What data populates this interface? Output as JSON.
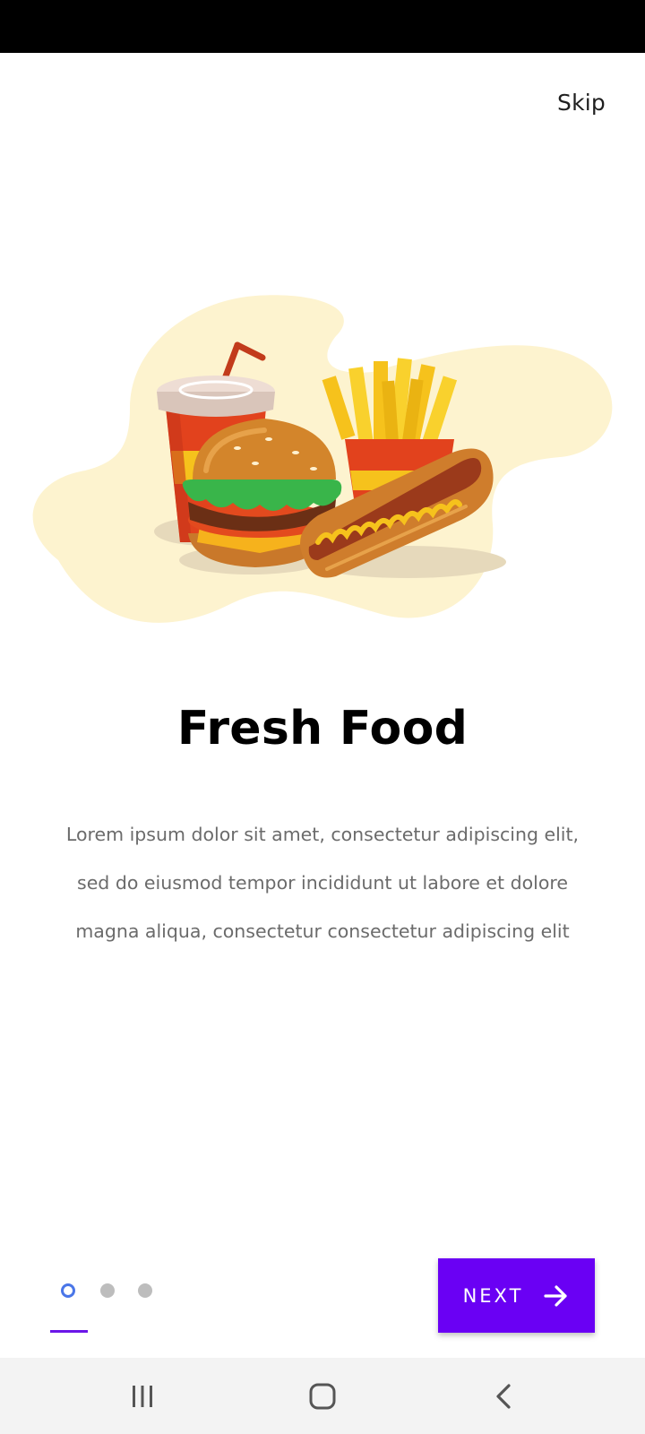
{
  "header": {
    "skip_label": "Skip"
  },
  "slide": {
    "title": "Fresh Food",
    "description": "Lorem ipsum dolor sit amet, consectetur adipiscing elit, sed do eiusmod tempor incididunt ut labore et dolore magna aliqua, consectetur  consectetur adipiscing elit"
  },
  "pager": {
    "total_pages": 3,
    "current_page": 1
  },
  "footer": {
    "next_label": "NEXT",
    "next_icon": "arrow-right-icon"
  },
  "nav": {
    "icons": [
      "recent-apps-icon",
      "home-icon",
      "back-icon"
    ]
  },
  "colors": {
    "accent": "#6a00f4",
    "active_dot": "#4a76e8",
    "inactive_dot": "#bdbdbd",
    "blob": "#fdf3cf",
    "status_bar": "#000000",
    "nav_bar": "#f3f3f3"
  }
}
